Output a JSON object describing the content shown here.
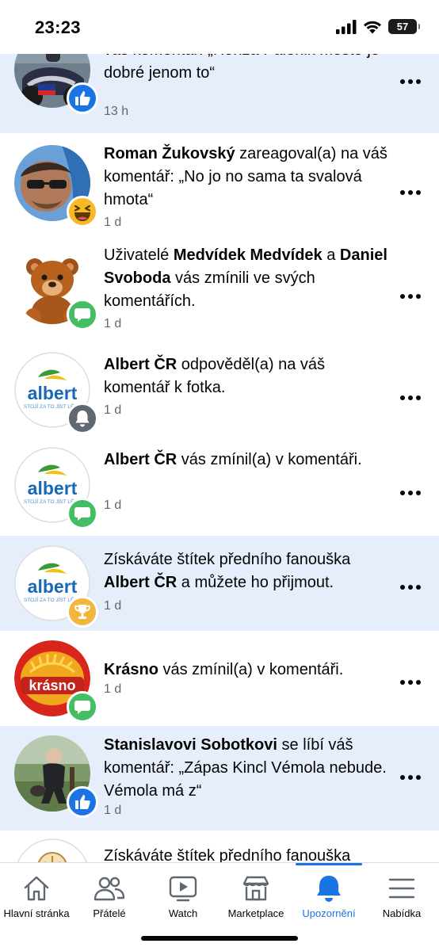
{
  "status_bar": {
    "time": "23:23",
    "battery": "57"
  },
  "notifications": [
    {
      "id": "n1",
      "state": "unread",
      "badge": "like",
      "avatar": "motorbike-photo",
      "parts": [
        {
          "t": "váš komentář: „Honza Palenik město je dobré jenom to“",
          "b": false
        }
      ],
      "time": "13 h"
    },
    {
      "id": "n2",
      "state": "read",
      "badge": "haha",
      "avatar": "man-sunglasses-photo",
      "parts": [
        {
          "t": "Roman Žukovský",
          "b": true
        },
        {
          "t": " zareagoval(a) na váš komentář: „No jo no sama ta svalová hmota“",
          "b": false
        }
      ],
      "time": "1 d"
    },
    {
      "id": "n3",
      "state": "read",
      "badge": "comment",
      "avatar": "teddy-bear-photo",
      "parts": [
        {
          "t": "Uživatelé ",
          "b": false
        },
        {
          "t": "Medvídek Medvídek",
          "b": true
        },
        {
          "t": " a ",
          "b": false
        },
        {
          "t": "Daniel Svoboda",
          "b": true
        },
        {
          "t": " vás zmínili ve svých komentářích.",
          "b": false
        }
      ],
      "time": "1 d"
    },
    {
      "id": "n4",
      "state": "read",
      "badge": "bell",
      "avatar": "albert-logo",
      "parts": [
        {
          "t": "Albert ČR",
          "b": true
        },
        {
          "t": " odpověděl(a) na váš komentář k fotka.",
          "b": false
        }
      ],
      "time": "1 d"
    },
    {
      "id": "n5",
      "state": "read",
      "badge": "comment",
      "avatar": "albert-logo",
      "parts": [
        {
          "t": "Albert ČR",
          "b": true
        },
        {
          "t": " vás zmínil(a) v komentáři.",
          "b": false
        }
      ],
      "time": "1 d"
    },
    {
      "id": "n6",
      "state": "unread",
      "badge": "trophy",
      "avatar": "albert-logo",
      "parts": [
        {
          "t": "Získáváte štítek předního fanouška ",
          "b": false
        },
        {
          "t": "Albert ČR",
          "b": true
        },
        {
          "t": " a můžete ho přijmout.",
          "b": false
        }
      ],
      "time": "1 d"
    },
    {
      "id": "n7",
      "state": "read",
      "badge": "comment",
      "avatar": "krasno-logo",
      "parts": [
        {
          "t": "Krásno",
          "b": true
        },
        {
          "t": " vás zmínil(a) v komentáři.",
          "b": false
        }
      ],
      "time": "1 d"
    },
    {
      "id": "n8",
      "state": "unread",
      "badge": "like",
      "avatar": "man-garden-photo",
      "parts": [
        {
          "t": "Stanislavovi Sobotkovi",
          "b": true
        },
        {
          "t": " se líbí váš komentář: „Zápas Kincl Vémola nebude. Vémola má z“",
          "b": false
        }
      ],
      "time": "1 d"
    },
    {
      "id": "n9",
      "state": "read",
      "badge": "",
      "avatar": "round-logo",
      "parts": [
        {
          "t": "Získáváte štítek předního fanouška",
          "b": false
        }
      ],
      "time": ""
    }
  ],
  "albert_logo_text": "albert",
  "albert_slogan": "STOJÍ ZA TO JÍST LÉPE",
  "krasno_logo_text": "krásno",
  "tabs": [
    {
      "label": "Hlavní stránka",
      "icon": "home-icon",
      "active": false
    },
    {
      "label": "Přátelé",
      "icon": "friends-icon",
      "active": false
    },
    {
      "label": "Watch",
      "icon": "watch-icon",
      "active": false
    },
    {
      "label": "Marketplace",
      "icon": "marketplace-icon",
      "active": false
    },
    {
      "label": "Upozornění",
      "icon": "bell-icon",
      "active": true
    },
    {
      "label": "Nabídka",
      "icon": "menu-icon",
      "active": false
    }
  ],
  "colors": {
    "accent": "#1b74e4",
    "unread_bg": "#e6eefb",
    "comment_badge": "#45bd62",
    "trophy_badge": "#f0b73c"
  }
}
